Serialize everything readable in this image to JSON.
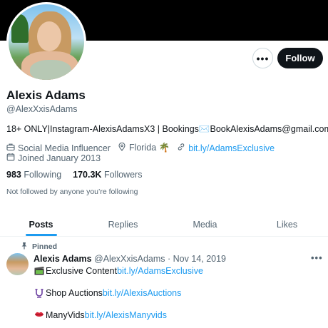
{
  "profile": {
    "name": "Alexis Adams",
    "handle": "@AlexXxisAdams",
    "bio": "18+ ONLY|Instagram-AlexisAdamsX3 | Bookings✉️BookAlexisAdams@gmail.com",
    "category": "Social Media Influencer",
    "location": "Florida 🌴",
    "website": "bit.ly/AdamsExclusive",
    "joined": "Joined January 2013",
    "following_count": "983",
    "following_label": "Following",
    "followers_count": "170.3K",
    "followers_label": "Followers",
    "not_followed": "Not followed by anyone you’re following"
  },
  "actions": {
    "more": "•••",
    "follow": "Follow"
  },
  "tabs": [
    {
      "label": "Posts",
      "active": true
    },
    {
      "label": "Replies"
    },
    {
      "label": "Media"
    },
    {
      "label": "Likes"
    }
  ],
  "post": {
    "pinned": "Pinned",
    "author": "Alexis Adams",
    "handle_date": "@AlexXxisAdams · Nov 14, 2019",
    "more": "•••",
    "line1_text": "Exclusive Content ",
    "line1_link": "bit.ly/AdamsExclusive",
    "line2_text": "Shop Auctions ",
    "line2_link": "bit.ly/AlexisAuctions",
    "line3_text": "ManyVids ",
    "line3_link": "bit.ly/AlexisManyvids"
  },
  "icons": {
    "category": "briefcase-icon",
    "location": "location-pin-icon",
    "website": "link-icon",
    "joined": "calendar-icon",
    "pin": "pin-icon"
  },
  "colors": {
    "accent": "#1d9bf0",
    "text": "#0f1419",
    "muted": "#536471",
    "banner": "#000000"
  }
}
